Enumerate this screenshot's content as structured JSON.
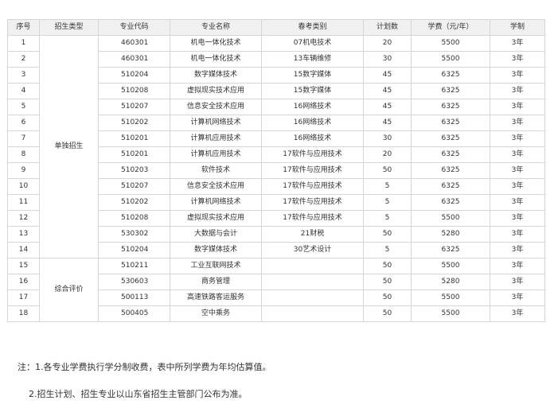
{
  "table": {
    "headers": [
      "序号",
      "招生类型",
      "专业代码",
      "专业名称",
      "春考类别",
      "计划数",
      "学费（元/年）",
      "学制"
    ],
    "groups": [
      {
        "label": "单独招生",
        "rows": 14
      },
      {
        "label": "综合评价",
        "rows": 4
      }
    ],
    "rows": [
      {
        "no": "1",
        "code": "460301",
        "major": "机电一体化技术",
        "category": "07机电技术",
        "plan": "20",
        "fee": "5500",
        "years": "3年"
      },
      {
        "no": "2",
        "code": "460301",
        "major": "机电一体化技术",
        "category": "13车辆维修",
        "plan": "30",
        "fee": "5500",
        "years": "3年"
      },
      {
        "no": "3",
        "code": "510204",
        "major": "数字媒体技术",
        "category": "15数字媒体",
        "plan": "45",
        "fee": "6325",
        "years": "3年"
      },
      {
        "no": "4",
        "code": "510208",
        "major": "虚拟现实技术应用",
        "category": "15数字媒体",
        "plan": "45",
        "fee": "6325",
        "years": "3年"
      },
      {
        "no": "5",
        "code": "510207",
        "major": "信息安全技术应用",
        "category": "16网络技术",
        "plan": "45",
        "fee": "6325",
        "years": "3年"
      },
      {
        "no": "6",
        "code": "510202",
        "major": "计算机网络技术",
        "category": "16网络技术",
        "plan": "45",
        "fee": "6325",
        "years": "3年"
      },
      {
        "no": "7",
        "code": "510201",
        "major": "计算机应用技术",
        "category": "16网络技术",
        "plan": "30",
        "fee": "6325",
        "years": "3年"
      },
      {
        "no": "8",
        "code": "510201",
        "major": "计算机应用技术",
        "category": "17软件与应用技术",
        "plan": "20",
        "fee": "6325",
        "years": "3年"
      },
      {
        "no": "9",
        "code": "510203",
        "major": "软件技术",
        "category": "17软件与应用技术",
        "plan": "50",
        "fee": "6325",
        "years": "3年"
      },
      {
        "no": "10",
        "code": "510207",
        "major": "信息安全技术应用",
        "category": "17软件与应用技术",
        "plan": "5",
        "fee": "6325",
        "years": "3年"
      },
      {
        "no": "11",
        "code": "510202",
        "major": "计算机网络技术",
        "category": "17软件与应用技术",
        "plan": "5",
        "fee": "6325",
        "years": "3年"
      },
      {
        "no": "12",
        "code": "510208",
        "major": "虚拟现实技术应用",
        "category": "17软件与应用技术",
        "plan": "5",
        "fee": "5500",
        "years": "3年"
      },
      {
        "no": "13",
        "code": "530302",
        "major": "大数据与会计",
        "category": "21财税",
        "plan": "50",
        "fee": "5280",
        "years": "3年"
      },
      {
        "no": "14",
        "code": "510204",
        "major": "数字媒体技术",
        "category": "30艺术设计",
        "plan": "5",
        "fee": "6325",
        "years": "3年"
      },
      {
        "no": "15",
        "code": "510211",
        "major": "工业互联网技术",
        "category": "",
        "plan": "50",
        "fee": "5500",
        "years": "3年"
      },
      {
        "no": "16",
        "code": "530603",
        "major": "商务管理",
        "category": "",
        "plan": "50",
        "fee": "5280",
        "years": "3年"
      },
      {
        "no": "17",
        "code": "500113",
        "major": "高速铁路客运服务",
        "category": "",
        "plan": "50",
        "fee": "5500",
        "years": "3年"
      },
      {
        "no": "18",
        "code": "500405",
        "major": "空中乘务",
        "category": "",
        "plan": "50",
        "fee": "5500",
        "years": "3年"
      }
    ]
  },
  "notes": {
    "note1": "注：1.各专业学费执行学分制收费，表中所列学费为年均估算值。",
    "note2": "2.招生计划、招生专业以山东省招生主管部门公布为准。"
  }
}
